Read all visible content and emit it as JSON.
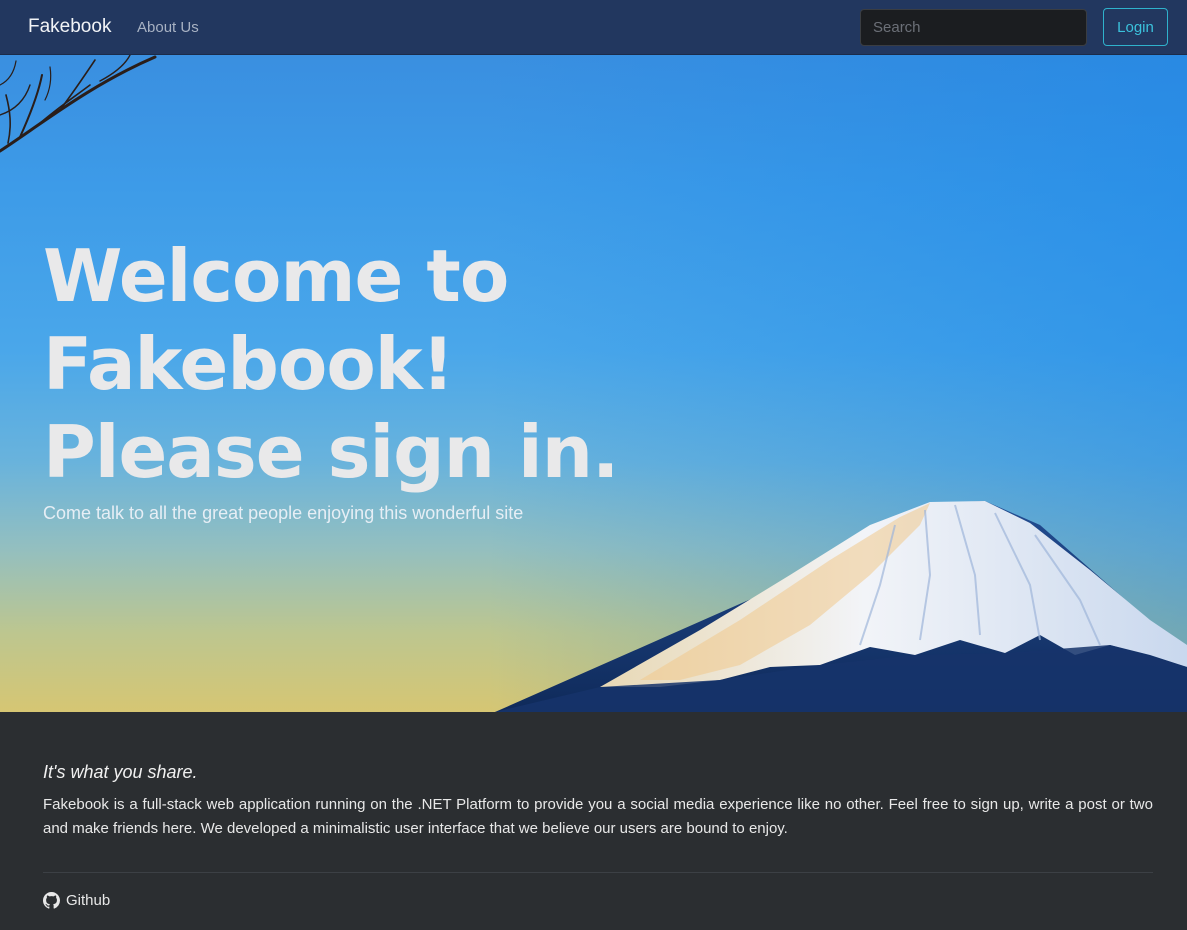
{
  "navbar": {
    "brand": "Fakebook",
    "links": [
      {
        "label": "About Us"
      }
    ],
    "search": {
      "placeholder": "Search",
      "value": ""
    },
    "login_label": "Login"
  },
  "hero": {
    "title_lines": [
      "Welcome to",
      "Fakebook!",
      "Please sign in."
    ],
    "subtitle": "Come talk to all the great people enjoying this wonderful site"
  },
  "about": {
    "heading": "It's what you share.",
    "text": "Fakebook is a full-stack web application running on the .NET Platform to provide you a social media experience like no other. Feel free to sign up, write a post or two and make friends here. We developed a minimalistic user interface that we believe our users are bound to enjoy.",
    "github_label": "Github",
    "github_icon": "github-icon"
  },
  "colors": {
    "navbar_bg": "#22375f",
    "login_accent": "#2fb2cc",
    "footer_bg": "#2b2e31"
  }
}
